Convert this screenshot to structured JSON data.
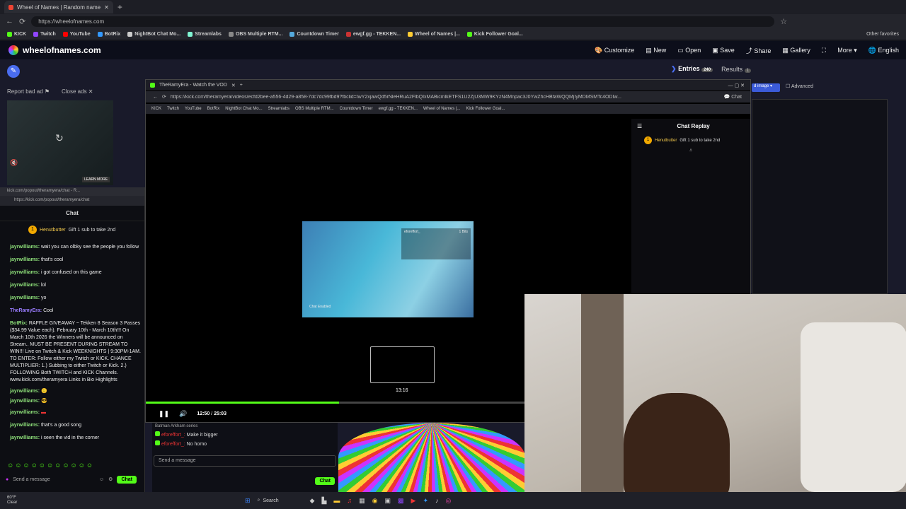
{
  "browser": {
    "tab_title": "Wheel of Names | Random name",
    "url": "https://wheelofnames.com",
    "bookmarks": [
      "KICK",
      "Twitch",
      "YouTube",
      "BotRix",
      "NightBot Chat Mo...",
      "Streamlabs",
      "OBS Multiple RTM...",
      "Countdown Timer",
      "ewgf.gg - TEKKEN...",
      "Wheel of Names |...",
      "Kick Follower Goal..."
    ],
    "other_favorites": "Other favorites"
  },
  "site": {
    "title": "wheelofnames.com",
    "nav": [
      "Customize",
      "New",
      "Open",
      "Save",
      "Share",
      "Gallery",
      "More",
      "English"
    ],
    "report_ad": "Report bad ad",
    "close_ads": "Close ads",
    "learn_more": "LEARN MORE",
    "entries_tab": "Entries",
    "entries_count": "240",
    "results_tab": "Results",
    "results_count": "1",
    "advanced": "Advanced"
  },
  "popout": {
    "url": "kick.com/popout/theramyera/chat - R...",
    "url_full": "https://kick.com/popout/theramyera/chat",
    "title": "Chat",
    "gift": {
      "user": "Henutbutter",
      "text": "Gift 1 sub to take 2nd"
    },
    "messages": [
      {
        "user": "jayrwilliams:",
        "text": "wait you can olbky see the people you follow"
      },
      {
        "user": "jayrwilliams:",
        "text": "that's cool"
      },
      {
        "user": "jayrwilliams:",
        "text": "i got confused on this game"
      },
      {
        "user": "jayrwilliams:",
        "text": "lol"
      },
      {
        "user": "jayrwilliams:",
        "text": "yo"
      },
      {
        "user": "TheRamyEra:",
        "text": "Cool"
      },
      {
        "user": "BotRix:",
        "text": "RAFFLE GIVEAWAY ~ Tekken 8 Season 3 Passes ($34.99 Value each). February 10th - March 10th!!! On March 10th 2026 the Winners will be announced on Stream.. MUST BE PRESENT DURING STREAM TO WIN!!! Live on Twitch & Kick WEEKNIGHTS | 9:30PM-1AM. TO ENTER: Follow either my Twitch or KICK. CHANCE MULTIPLIER: 1.) Subbing to either Twitch or Kick. 2.) FOLLOWING Both TWITCH and KICK Channels. www.kick.com/theramyera Links in Bio Highlights"
      },
      {
        "user": "jayrwilliams:",
        "text": ""
      },
      {
        "user": "jayrwilliams:",
        "text": ""
      },
      {
        "user": "jayrwilliams:",
        "text": ""
      },
      {
        "user": "jayrwilliams:",
        "text": "that's a good song"
      },
      {
        "user": "jayrwilliams:",
        "text": "i seen the vid in the corner"
      }
    ],
    "send_placeholder": "Send a message",
    "chat_button": "Chat"
  },
  "video_window": {
    "tab_title": "TheRamyEra - Watch the VOD",
    "url": "https://kick.com/theramyera/videos/ecfd2bee-a556-4d29-a858-7dc7dc99fbd9?fbclid=IwY2xjawQd5rNleHRuA2FlbQIxMABicmlkETFS1U2ZjU3MW9KYzN4Mnpac3J0YwZhcHBfaWQQMjIyMDMSMTc4ODIw...",
    "bookmarks": [
      "KICK",
      "Twitch",
      "YouTube",
      "BotRix",
      "NightBot Chat Mo...",
      "Streamlabs",
      "OBS Multiple RTM...",
      "Countdown Timer",
      "ewgf.gg - TEKKEN...",
      "Wheel of Names |...",
      "Kick Follower Goal..."
    ],
    "chat_replay_title": "Chat Replay",
    "replay_gift": {
      "user": "Henutbutter",
      "text": "Gift 1 sub to take 2nd"
    },
    "preview_time": "13:16",
    "current_time": "12:50",
    "total_time": "25:03",
    "progress": 0.51,
    "inner_chat": {
      "user": "eforeffort_",
      "text": "1 Bits",
      "chat_enabled": "Chat Enabled"
    }
  },
  "wheel_chat": {
    "context": "Batman Arkham series",
    "messages": [
      {
        "user": "eforeffort_:",
        "text": "Make it bigger"
      },
      {
        "user": "eforeffort_:",
        "text": "No homo"
      }
    ],
    "send_placeholder": "Send a message",
    "chat_button": "Chat"
  },
  "taskbar": {
    "weather": "60°F",
    "weather_sub": "Clear",
    "search": "Search"
  }
}
